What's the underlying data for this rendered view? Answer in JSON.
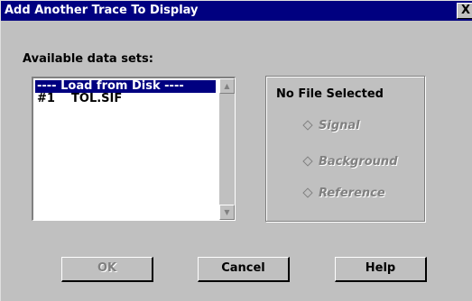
{
  "window": {
    "title": "Add Another Trace To Display",
    "close_glyph": "X"
  },
  "available": {
    "label": "Available data sets:",
    "items": [
      {
        "text": "---- Load from Disk ----",
        "selected": true
      },
      {
        "text": "#1    TOL.SIF",
        "selected": false
      }
    ],
    "scroll_up_glyph": "▲",
    "scroll_down_glyph": "▼"
  },
  "file_panel": {
    "status": "No File Selected",
    "options": [
      {
        "label": "Signal",
        "enabled": false
      },
      {
        "label": "Background",
        "enabled": false
      },
      {
        "label": "Reference",
        "enabled": false
      }
    ]
  },
  "buttons": {
    "ok": {
      "label": "OK",
      "enabled": false
    },
    "cancel": {
      "label": "Cancel",
      "enabled": true
    },
    "help": {
      "label": "Help",
      "enabled": true
    }
  },
  "colors": {
    "titlebar": "#000080",
    "face": "#c0c0c0",
    "selection": "#000080",
    "disabled_text": "#808080"
  }
}
